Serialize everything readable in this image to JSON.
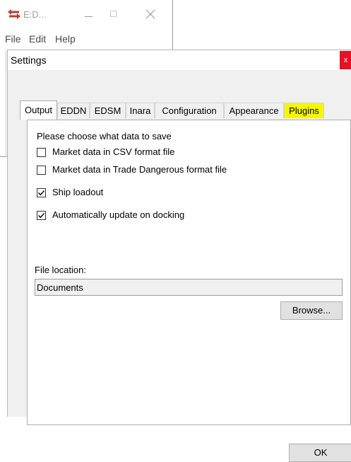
{
  "main_window": {
    "title": "E:D...",
    "menu": [
      "File",
      "Edit",
      "Help"
    ]
  },
  "settings": {
    "title": "Settings",
    "close_glyph": "x",
    "tabs": [
      {
        "label": "Output",
        "active": true
      },
      {
        "label": "EDDN"
      },
      {
        "label": "EDSM"
      },
      {
        "label": "Inara"
      },
      {
        "label": "Configuration"
      },
      {
        "label": "Appearance"
      },
      {
        "label": "Plugins",
        "highlighted": true
      }
    ],
    "output": {
      "prompt": "Please choose what data to save",
      "options": [
        {
          "label": "Market data in CSV format file",
          "checked": false
        },
        {
          "label": "Market data in Trade Dangerous format file",
          "checked": false
        },
        {
          "label": "Ship loadout",
          "checked": true
        },
        {
          "label": "Automatically update on docking",
          "checked": true
        }
      ],
      "file_location_label": "File location:",
      "file_location_value": "Documents",
      "browse_label": "Browse..."
    },
    "ok_label": "OK"
  },
  "colors": {
    "highlight": "#f6f600",
    "close_red": "#e81123",
    "panel_bg": "#f0f0f0"
  }
}
